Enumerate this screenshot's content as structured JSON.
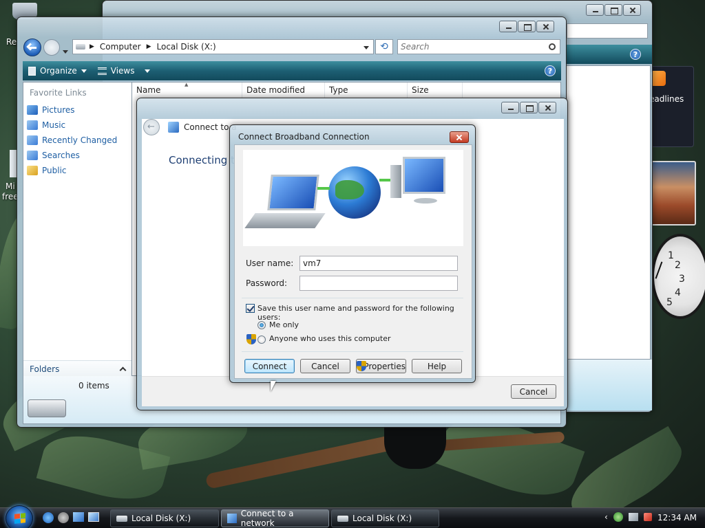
{
  "desktop": {
    "icon_label_1": "Re",
    "icon_label_2a": "Mi",
    "icon_label_2b": "free"
  },
  "sidebar": {
    "feed_label": "eadlines",
    "clock_numbers": [
      "1",
      "2",
      "3",
      "4",
      "5"
    ]
  },
  "explorer": {
    "breadcrumb": [
      "Computer",
      "Local Disk (X:)"
    ],
    "search_placeholder": "Search",
    "toolbar": {
      "organize": "Organize",
      "views": "Views",
      "help": "?"
    },
    "favorite_links_header": "Favorite Links",
    "favorites": [
      {
        "label": "Pictures",
        "icon": "pictures-icon",
        "color": "#3a7bd5"
      },
      {
        "label": "Music",
        "icon": "music-icon",
        "color": "#4a8fcc"
      },
      {
        "label": "Recently Changed",
        "icon": "recent-icon",
        "color": "#4a8fcc"
      },
      {
        "label": "Searches",
        "icon": "search-folder-icon",
        "color": "#4a8fcc"
      },
      {
        "label": "Public",
        "icon": "folder-icon",
        "color": "#e4b844"
      }
    ],
    "columns": [
      "Name",
      "Date modified",
      "Type",
      "Size"
    ],
    "folders_label": "Folders",
    "items_count": "0 items"
  },
  "connect_window": {
    "title": "Connect to a network",
    "title_visible": "Connect to a",
    "heading_visible": "Connecting t",
    "cancel": "Cancel"
  },
  "dialog": {
    "title": "Connect Broadband Connection",
    "username_label": "User name:",
    "username_value": "vm7",
    "password_label": "Password:",
    "password_value": "",
    "save_label": "Save this user name and password for the following users:",
    "save_checked": true,
    "option_me_only": "Me only",
    "option_anyone": "Anyone who uses this computer",
    "selected_option": "me_only",
    "buttons": {
      "connect": "Connect",
      "cancel": "Cancel",
      "properties": "Properties",
      "help": "Help"
    }
  },
  "taskbar": {
    "tasks": [
      {
        "label": "Local Disk (X:)"
      },
      {
        "label": "Connect to a network"
      },
      {
        "label": "Local Disk (X:)"
      }
    ],
    "time": "12:34 AM"
  }
}
